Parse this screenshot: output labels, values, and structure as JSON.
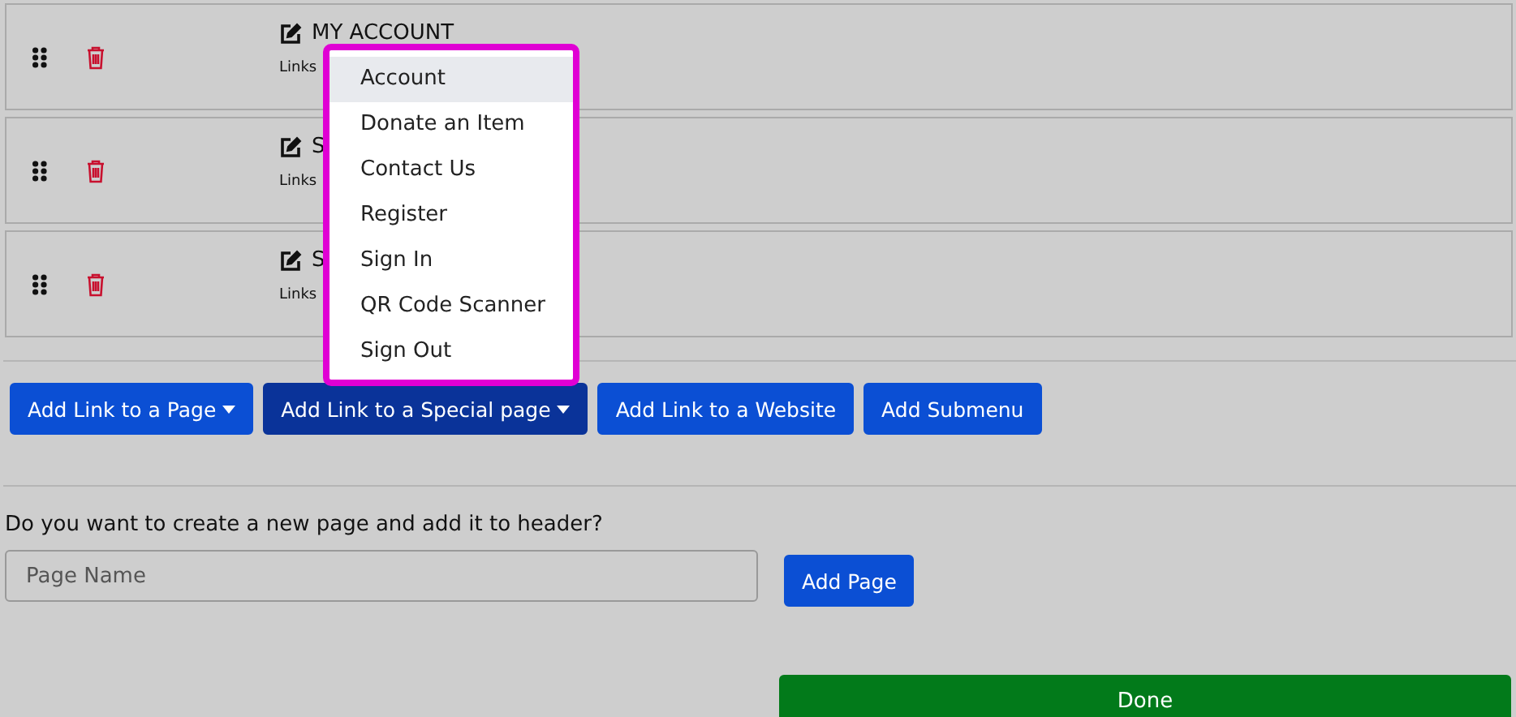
{
  "link_rows": [
    {
      "title": "MY ACCOUNT",
      "subtitle": "Links"
    },
    {
      "title": "S",
      "subtitle": "Links"
    },
    {
      "title": "S",
      "subtitle": "Links"
    }
  ],
  "buttons": [
    {
      "label": "Add Link to a Page",
      "dropdown": true,
      "selected": false
    },
    {
      "label": "Add Link to a Special page",
      "dropdown": true,
      "selected": true
    },
    {
      "label": "Add Link to a Website",
      "dropdown": false,
      "selected": false
    },
    {
      "label": "Add Submenu",
      "dropdown": false,
      "selected": false
    }
  ],
  "dropdown_menu": [
    {
      "label": "Account",
      "selected": true
    },
    {
      "label": "Donate an Item",
      "selected": false
    },
    {
      "label": "Contact Us",
      "selected": false
    },
    {
      "label": "Register",
      "selected": false
    },
    {
      "label": "Sign In",
      "selected": false
    },
    {
      "label": "QR Code Scanner",
      "selected": false
    },
    {
      "label": "Sign Out",
      "selected": false
    }
  ],
  "new_page": {
    "question": "Do you want to create a new page and add it to header?",
    "placeholder": "Page Name",
    "button": "Add Page"
  },
  "done_button": "Done"
}
